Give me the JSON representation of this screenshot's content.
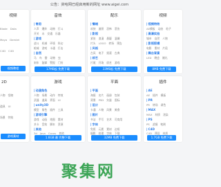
{
  "notice": "公告：资哈网已经启用新的网址 www.aigei.com",
  "cards": [
    {
      "id": "tl",
      "title": "视频",
      "sections": [
        "Blade",
        "Data",
        "Maya",
        "Demlet",
        "C4D",
        "C4D"
      ],
      "chips": [
        [
          "Blade",
          "Data"
        ],
        [
          "Maya",
          "Demlet"
        ],
        [
          "C4D",
          "C4D"
        ]
      ],
      "button": "视频教程"
    },
    {
      "id": "tm1",
      "title": "音效",
      "sections": [
        "常用",
        "游戏",
        "自然"
      ],
      "chips": [
        [
          "人声",
          "爆炸",
          "动物",
          "打斗"
        ],
        [
          "开关",
          "水",
          "交通",
          "乐器"
        ],
        [
          "战斗",
          "机械",
          "环境",
          "科幻"
        ],
        [
          "枪械",
          "游戏",
          "卡通",
          "打击"
        ],
        [
          "马",
          "鸟",
          "雷",
          "动物",
          "虫"
        ],
        [
          "刹车",
          "鼓掌",
          "警报",
          "门铃"
        ],
        [
          "人物",
          "动作",
          "情绪"
        ]
      ],
      "button": "17MB起 免费下载"
    },
    {
      "id": "tm2",
      "title": "配乐",
      "sections": [
        "情绪",
        "影视",
        "风格",
        "综艺"
      ],
      "chips": [
        [
          "欢快",
          "激昂",
          "恐怖",
          "悲伤"
        ],
        [
          "紧张",
          "浪漫",
          "悬疑",
          "温馨"
        ],
        [
          "片头",
          "LOGO",
          "转场",
          "预告"
        ],
        [
          "古风",
          "电子",
          "摇滚",
          "古典"
        ],
        [
          "片尾",
          "开场",
          "综艺",
          "游戏"
        ],
        [
          "搞笑",
          "卡通",
          "儿童",
          "休闲"
        ]
      ],
      "button": "33MB起 免费下载"
    },
    {
      "id": "tr",
      "title": "视频",
      "sections": [
        "视频特效",
        "高清实拍",
        "影视剪辑",
        "舞台背景"
      ],
      "chips": [
        [
          "AE模板",
          "动态",
          "粒子"
        ],
        [
          "城市",
          "自然",
          "人物"
        ],
        [
          "电影",
          "素材",
          "片段"
        ],
        [
          "LED",
          "晚会",
          "婚礼"
        ]
      ],
      "button": "8MB 免费下载"
    },
    {
      "id": "bl",
      "title": "2D",
      "sections": [],
      "chips": [
        [
          "人物",
          "怪物"
        ],
        [
          "道具",
          "UI"
        ],
        [
          "场景",
          "特效"
        ]
      ],
      "button": "游戏素材"
    },
    {
      "id": "bm1",
      "title": "游戏",
      "sections": [
        "动漫角色",
        "unity3D",
        "游戏引擎",
        "其他"
      ],
      "chips": [
        [
          "人物",
          "场景",
          "动作",
          "特效"
        ],
        [
          "武器",
          "道具",
          "界面",
          "UI"
        ],
        [
          "模型",
          "角色",
          "插件",
          "工具"
        ],
        [
          "游戏",
          "动画",
          "地图",
          "素材"
        ],
        [
          "关卡",
          "音效",
          "脚本",
          "资源"
        ],
        [
          "3d",
          "Java",
          "Cocos",
          "其他"
        ]
      ],
      "button": "1.6GB 最 完整下载"
    },
    {
      "id": "bm2",
      "title": "平面",
      "sections": [
        "平面",
        "设计",
        "图片",
        "字体"
      ],
      "chips": [
        [
          "海报",
          "名片",
          "画册",
          "包装"
        ],
        [
          "背景",
          "PSD",
          "矢量",
          "图标"
        ],
        [
          "卡通",
          "人物",
          "风景",
          "美食"
        ],
        [
          "书法",
          "手写",
          "艺术",
          "可商用"
        ],
        [
          "免抠",
          "元素",
          "素材",
          "边框"
        ],
        [
          "摄影",
          "纹理",
          "字体",
          "下载"
        ]
      ],
      "button": "32MB 免费下载"
    },
    {
      "id": "br",
      "title": "插件",
      "sections": [
        "AE",
        "PR",
        "MAX",
        "PS",
        "C4D"
      ],
      "chips": [
        [
          "AE",
          "插件",
          "模板"
        ],
        [
          "PR",
          "转场",
          "调色"
        ],
        [
          "MAX",
          "材质",
          "渲染"
        ],
        [
          "PS",
          "滤镜",
          "笔刷"
        ],
        [
          "C4D",
          "预设",
          "材质"
        ]
      ],
      "button": "1.7GB 免费下载"
    }
  ],
  "watermark": "聚集网"
}
